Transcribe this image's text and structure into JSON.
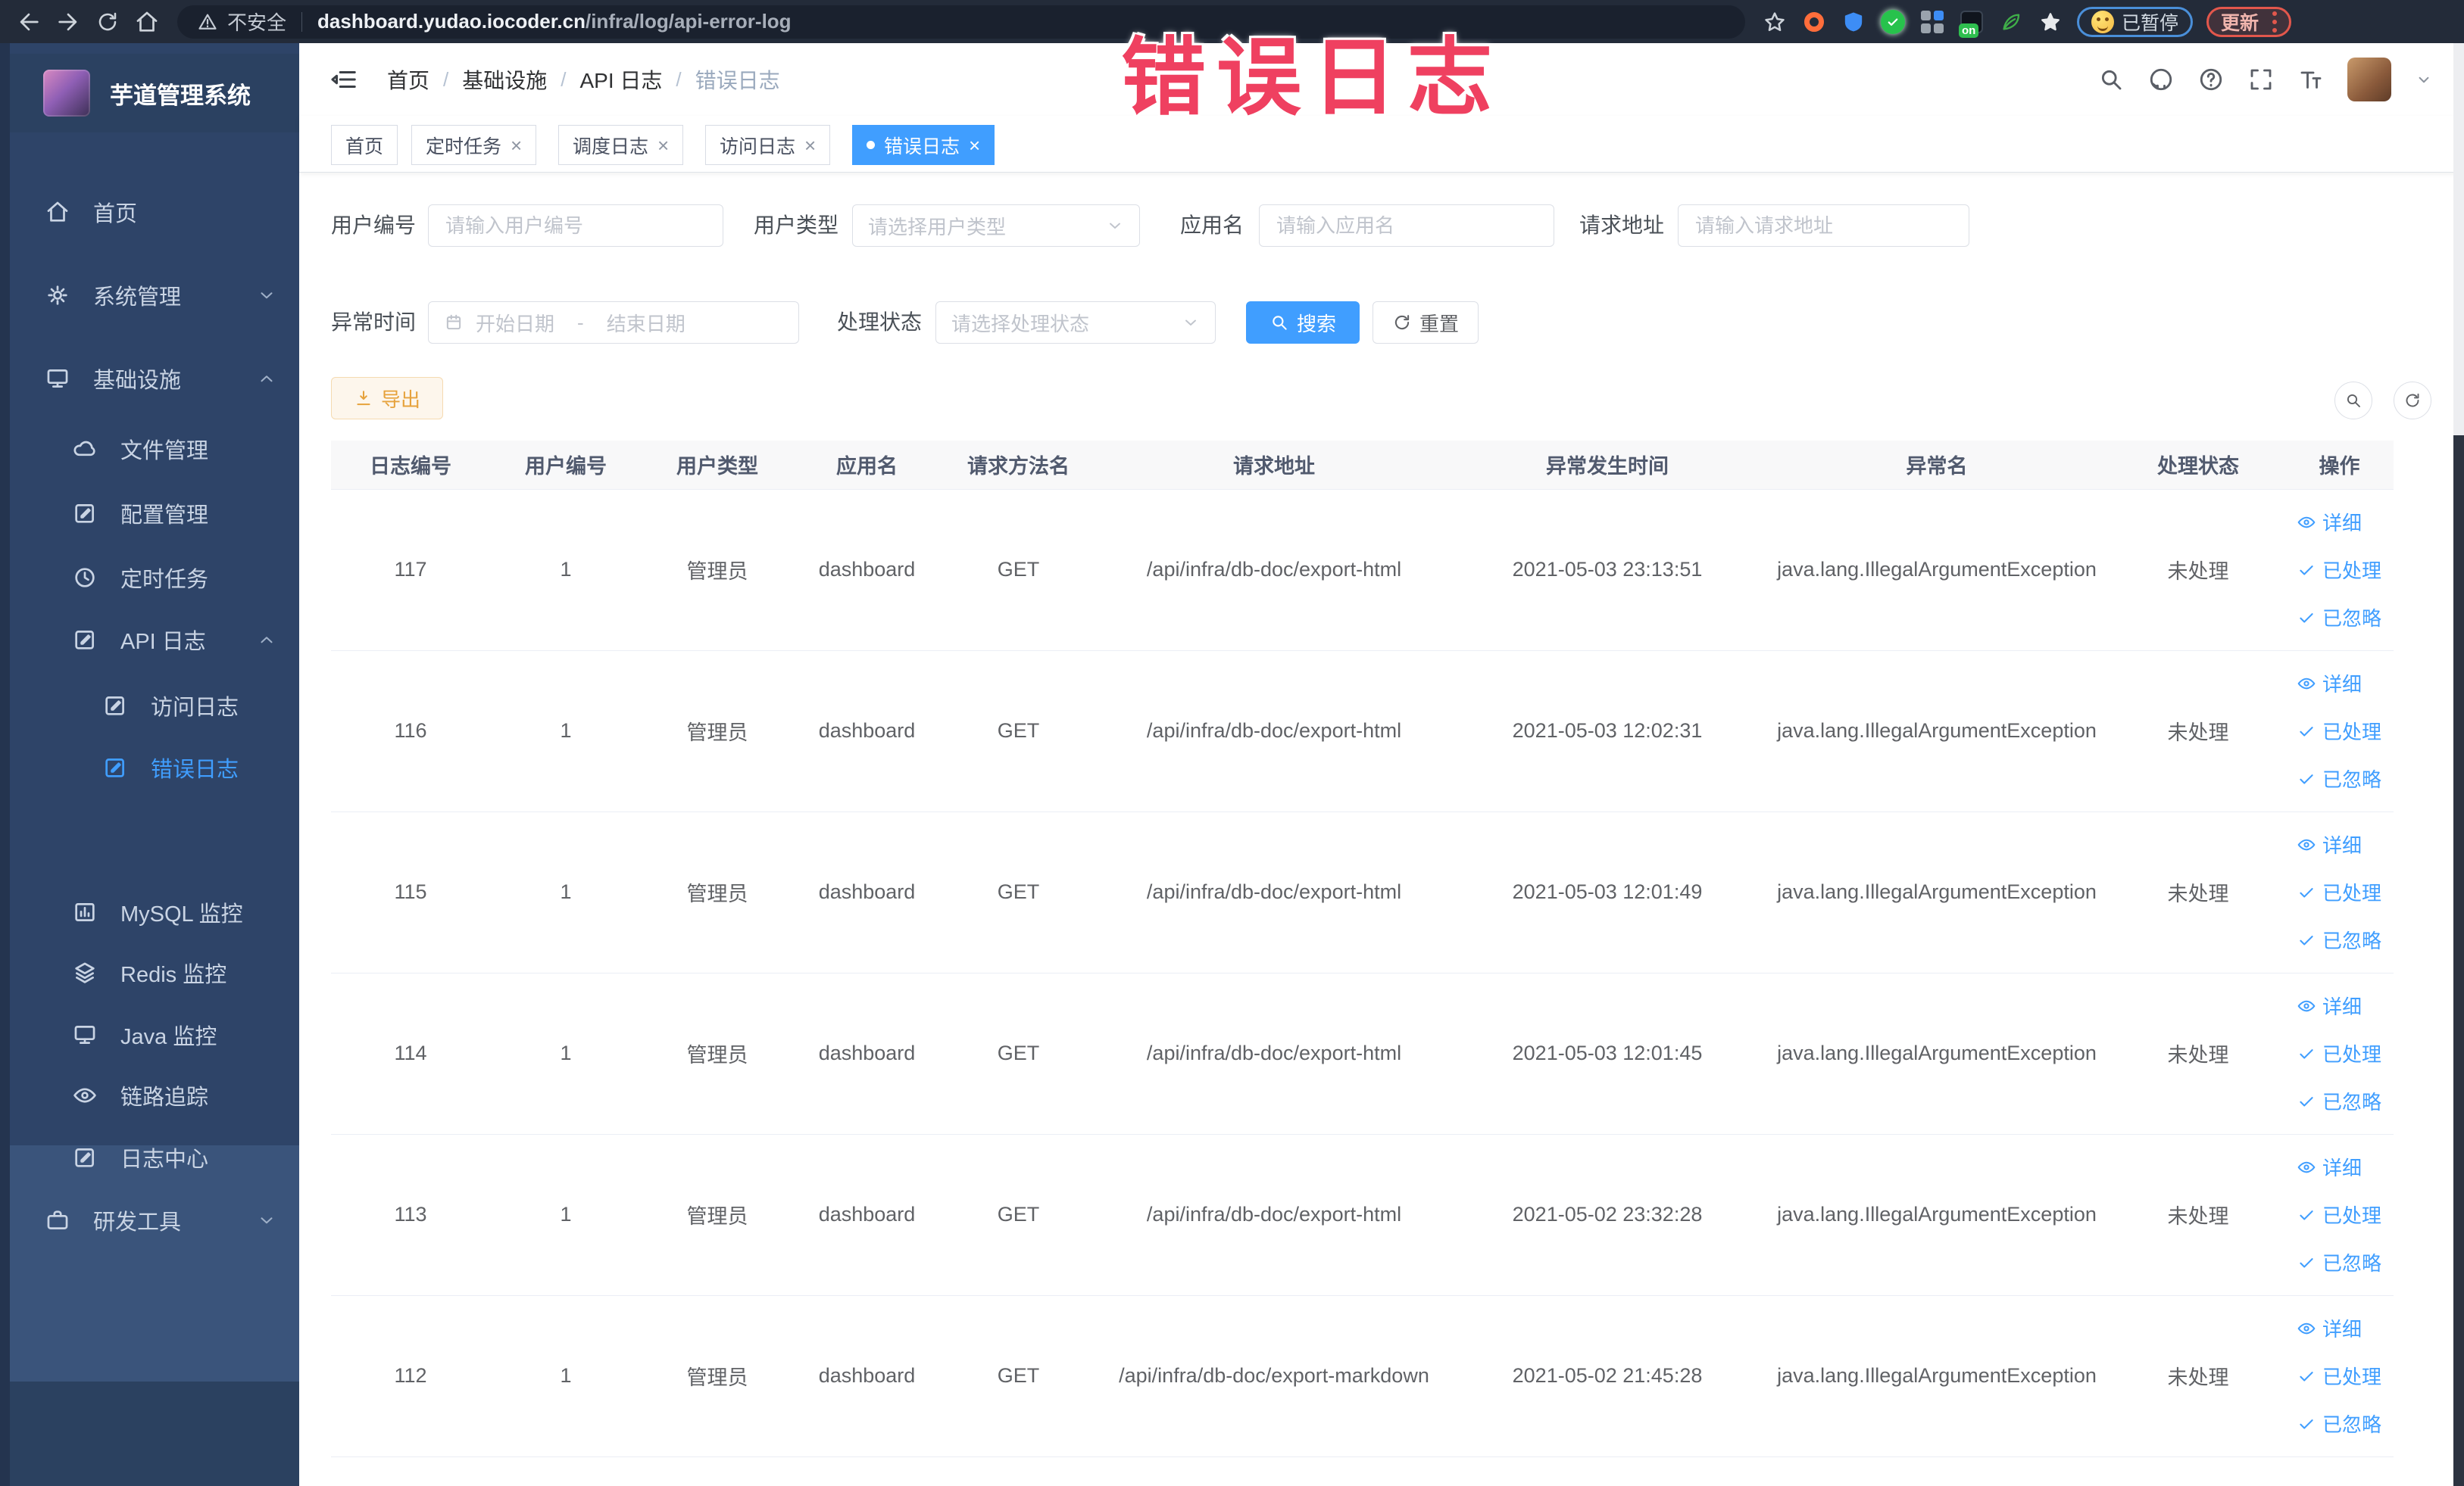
{
  "browser": {
    "security_label": "不安全",
    "url_domain": "dashboard.yudao.iocoder.cn",
    "url_path": "/infra/log/api-error-log",
    "ext_on_badge": "on",
    "paused_label": "已暂停",
    "update_label": "更新"
  },
  "annotation": {
    "text": "错误日志",
    "color": "#ef4060"
  },
  "sidebar": {
    "title": "芋道管理系统",
    "items": [
      {
        "label": "首页"
      },
      {
        "label": "系统管理"
      },
      {
        "label": "基础设施"
      },
      {
        "label": "文件管理"
      },
      {
        "label": "配置管理"
      },
      {
        "label": "定时任务"
      },
      {
        "label": "API 日志"
      },
      {
        "label": "访问日志"
      },
      {
        "label": "错误日志"
      },
      {
        "label": "MySQL 监控"
      },
      {
        "label": "Redis 监控"
      },
      {
        "label": "Java 监控"
      },
      {
        "label": "链路追踪"
      },
      {
        "label": "日志中心"
      },
      {
        "label": "研发工具"
      }
    ]
  },
  "breadcrumb": {
    "items": [
      "首页",
      "基础设施",
      "API 日志",
      "错误日志"
    ]
  },
  "tabs": [
    {
      "label": "首页"
    },
    {
      "label": "定时任务"
    },
    {
      "label": "调度日志"
    },
    {
      "label": "访问日志"
    },
    {
      "label": "错误日志"
    }
  ],
  "filters": {
    "user_id_label": "用户编号",
    "user_id_placeholder": "请输入用户编号",
    "user_type_label": "用户类型",
    "user_type_placeholder": "请选择用户类型",
    "app_name_label": "应用名",
    "app_name_placeholder": "请输入应用名",
    "request_url_label": "请求地址",
    "request_url_placeholder": "请输入请求地址",
    "exception_time_label": "异常时间",
    "date_start_placeholder": "开始日期",
    "date_separator": "-",
    "date_end_placeholder": "结束日期",
    "process_status_label": "处理状态",
    "process_status_placeholder": "请选择处理状态",
    "search_label": "搜索",
    "reset_label": "重置"
  },
  "toolbar": {
    "export_label": "导出"
  },
  "table": {
    "columns": [
      "日志编号",
      "用户编号",
      "用户类型",
      "应用名",
      "请求方法名",
      "请求地址",
      "异常发生时间",
      "异常名",
      "处理状态",
      "操作"
    ],
    "row_actions": {
      "detail": "详细",
      "processed": "已处理",
      "ignored": "已忽略"
    },
    "rows": [
      {
        "id": "117",
        "user_id": "1",
        "user_type": "管理员",
        "app_name": "dashboard",
        "method": "GET",
        "url": "/api/infra/db-doc/export-html",
        "time": "2021-05-03 23:13:51",
        "exception": "java.lang.IllegalArgumentException",
        "status": "未处理"
      },
      {
        "id": "116",
        "user_id": "1",
        "user_type": "管理员",
        "app_name": "dashboard",
        "method": "GET",
        "url": "/api/infra/db-doc/export-html",
        "time": "2021-05-03 12:02:31",
        "exception": "java.lang.IllegalArgumentException",
        "status": "未处理"
      },
      {
        "id": "115",
        "user_id": "1",
        "user_type": "管理员",
        "app_name": "dashboard",
        "method": "GET",
        "url": "/api/infra/db-doc/export-html",
        "time": "2021-05-03 12:01:49",
        "exception": "java.lang.IllegalArgumentException",
        "status": "未处理"
      },
      {
        "id": "114",
        "user_id": "1",
        "user_type": "管理员",
        "app_name": "dashboard",
        "method": "GET",
        "url": "/api/infra/db-doc/export-html",
        "time": "2021-05-03 12:01:45",
        "exception": "java.lang.IllegalArgumentException",
        "status": "未处理"
      },
      {
        "id": "113",
        "user_id": "1",
        "user_type": "管理员",
        "app_name": "dashboard",
        "method": "GET",
        "url": "/api/infra/db-doc/export-html",
        "time": "2021-05-02 23:32:28",
        "exception": "java.lang.IllegalArgumentException",
        "status": "未处理"
      },
      {
        "id": "112",
        "user_id": "1",
        "user_type": "管理员",
        "app_name": "dashboard",
        "method": "GET",
        "url": "/api/infra/db-doc/export-markdown",
        "time": "2021-05-02 21:45:28",
        "exception": "java.lang.IllegalArgumentException",
        "status": "未处理"
      }
    ]
  }
}
